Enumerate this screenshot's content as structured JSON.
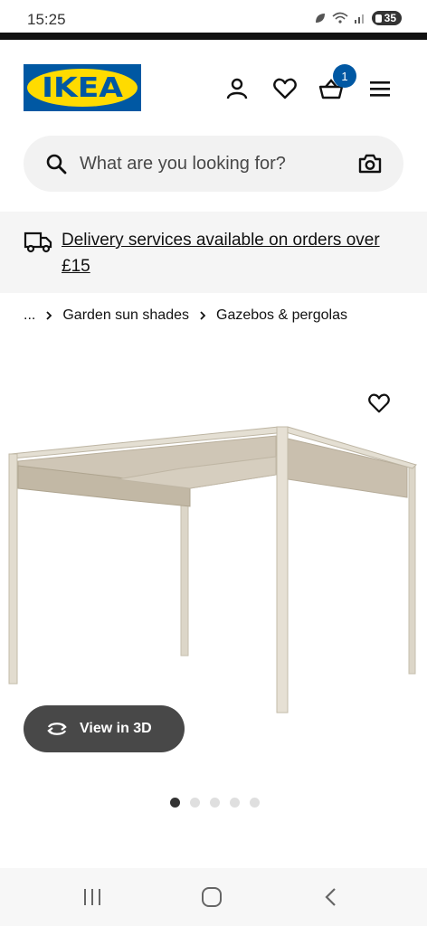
{
  "status": {
    "time": "15:25",
    "battery": "35"
  },
  "header": {
    "logo_text": "IKEA",
    "cart_count": "1"
  },
  "search": {
    "placeholder": "What are you looking for?"
  },
  "banner": {
    "text": "Delivery services available on orders over £15"
  },
  "breadcrumb": {
    "ellipsis": "...",
    "items": [
      "Garden sun shades",
      "Gazebos & pergolas"
    ]
  },
  "product": {
    "view3d_label": "View in 3D",
    "gallery_count": 5,
    "gallery_active": 1
  },
  "colors": {
    "brand_blue": "#0058a3",
    "brand_yellow": "#ffdb00",
    "button_dark": "#484848"
  }
}
